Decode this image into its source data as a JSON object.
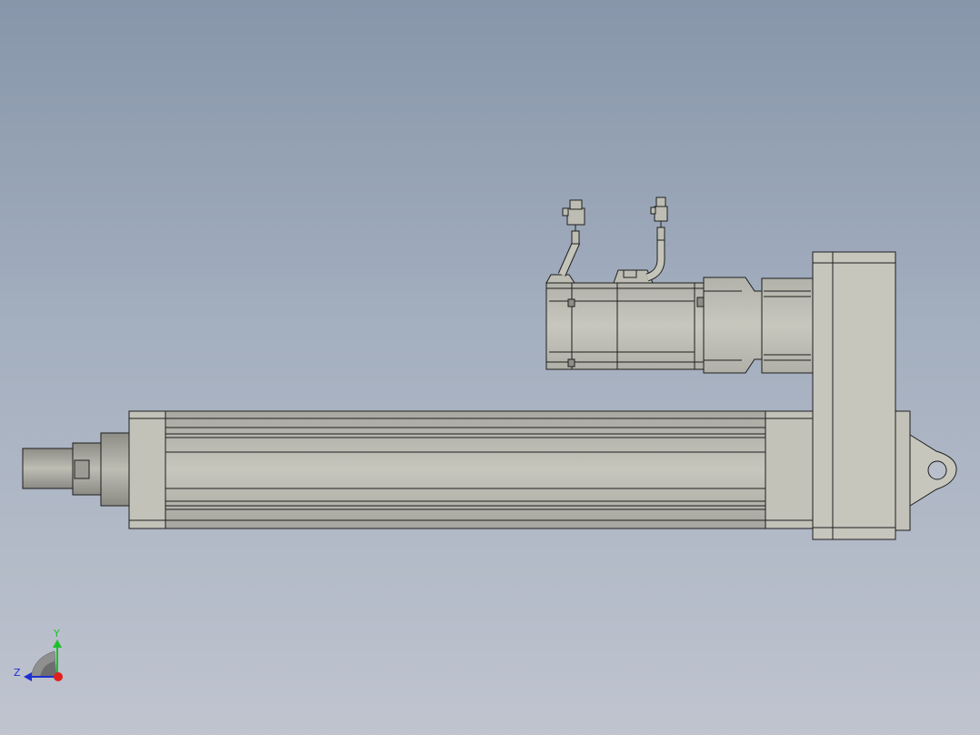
{
  "viewport": {
    "background_top": "#8796aa",
    "background_bottom": "#bfc4cf"
  },
  "model": {
    "part_fill": "#c4c4bb",
    "part_shade": "#a7a79f",
    "edge_color": "#1e1e1e"
  },
  "triad": {
    "y_label": "Y",
    "z_label": "Z",
    "y_axis_color": "#1fbf2a",
    "z_axis_color": "#1f2fd0",
    "x_axis_color": "#e0201f"
  }
}
